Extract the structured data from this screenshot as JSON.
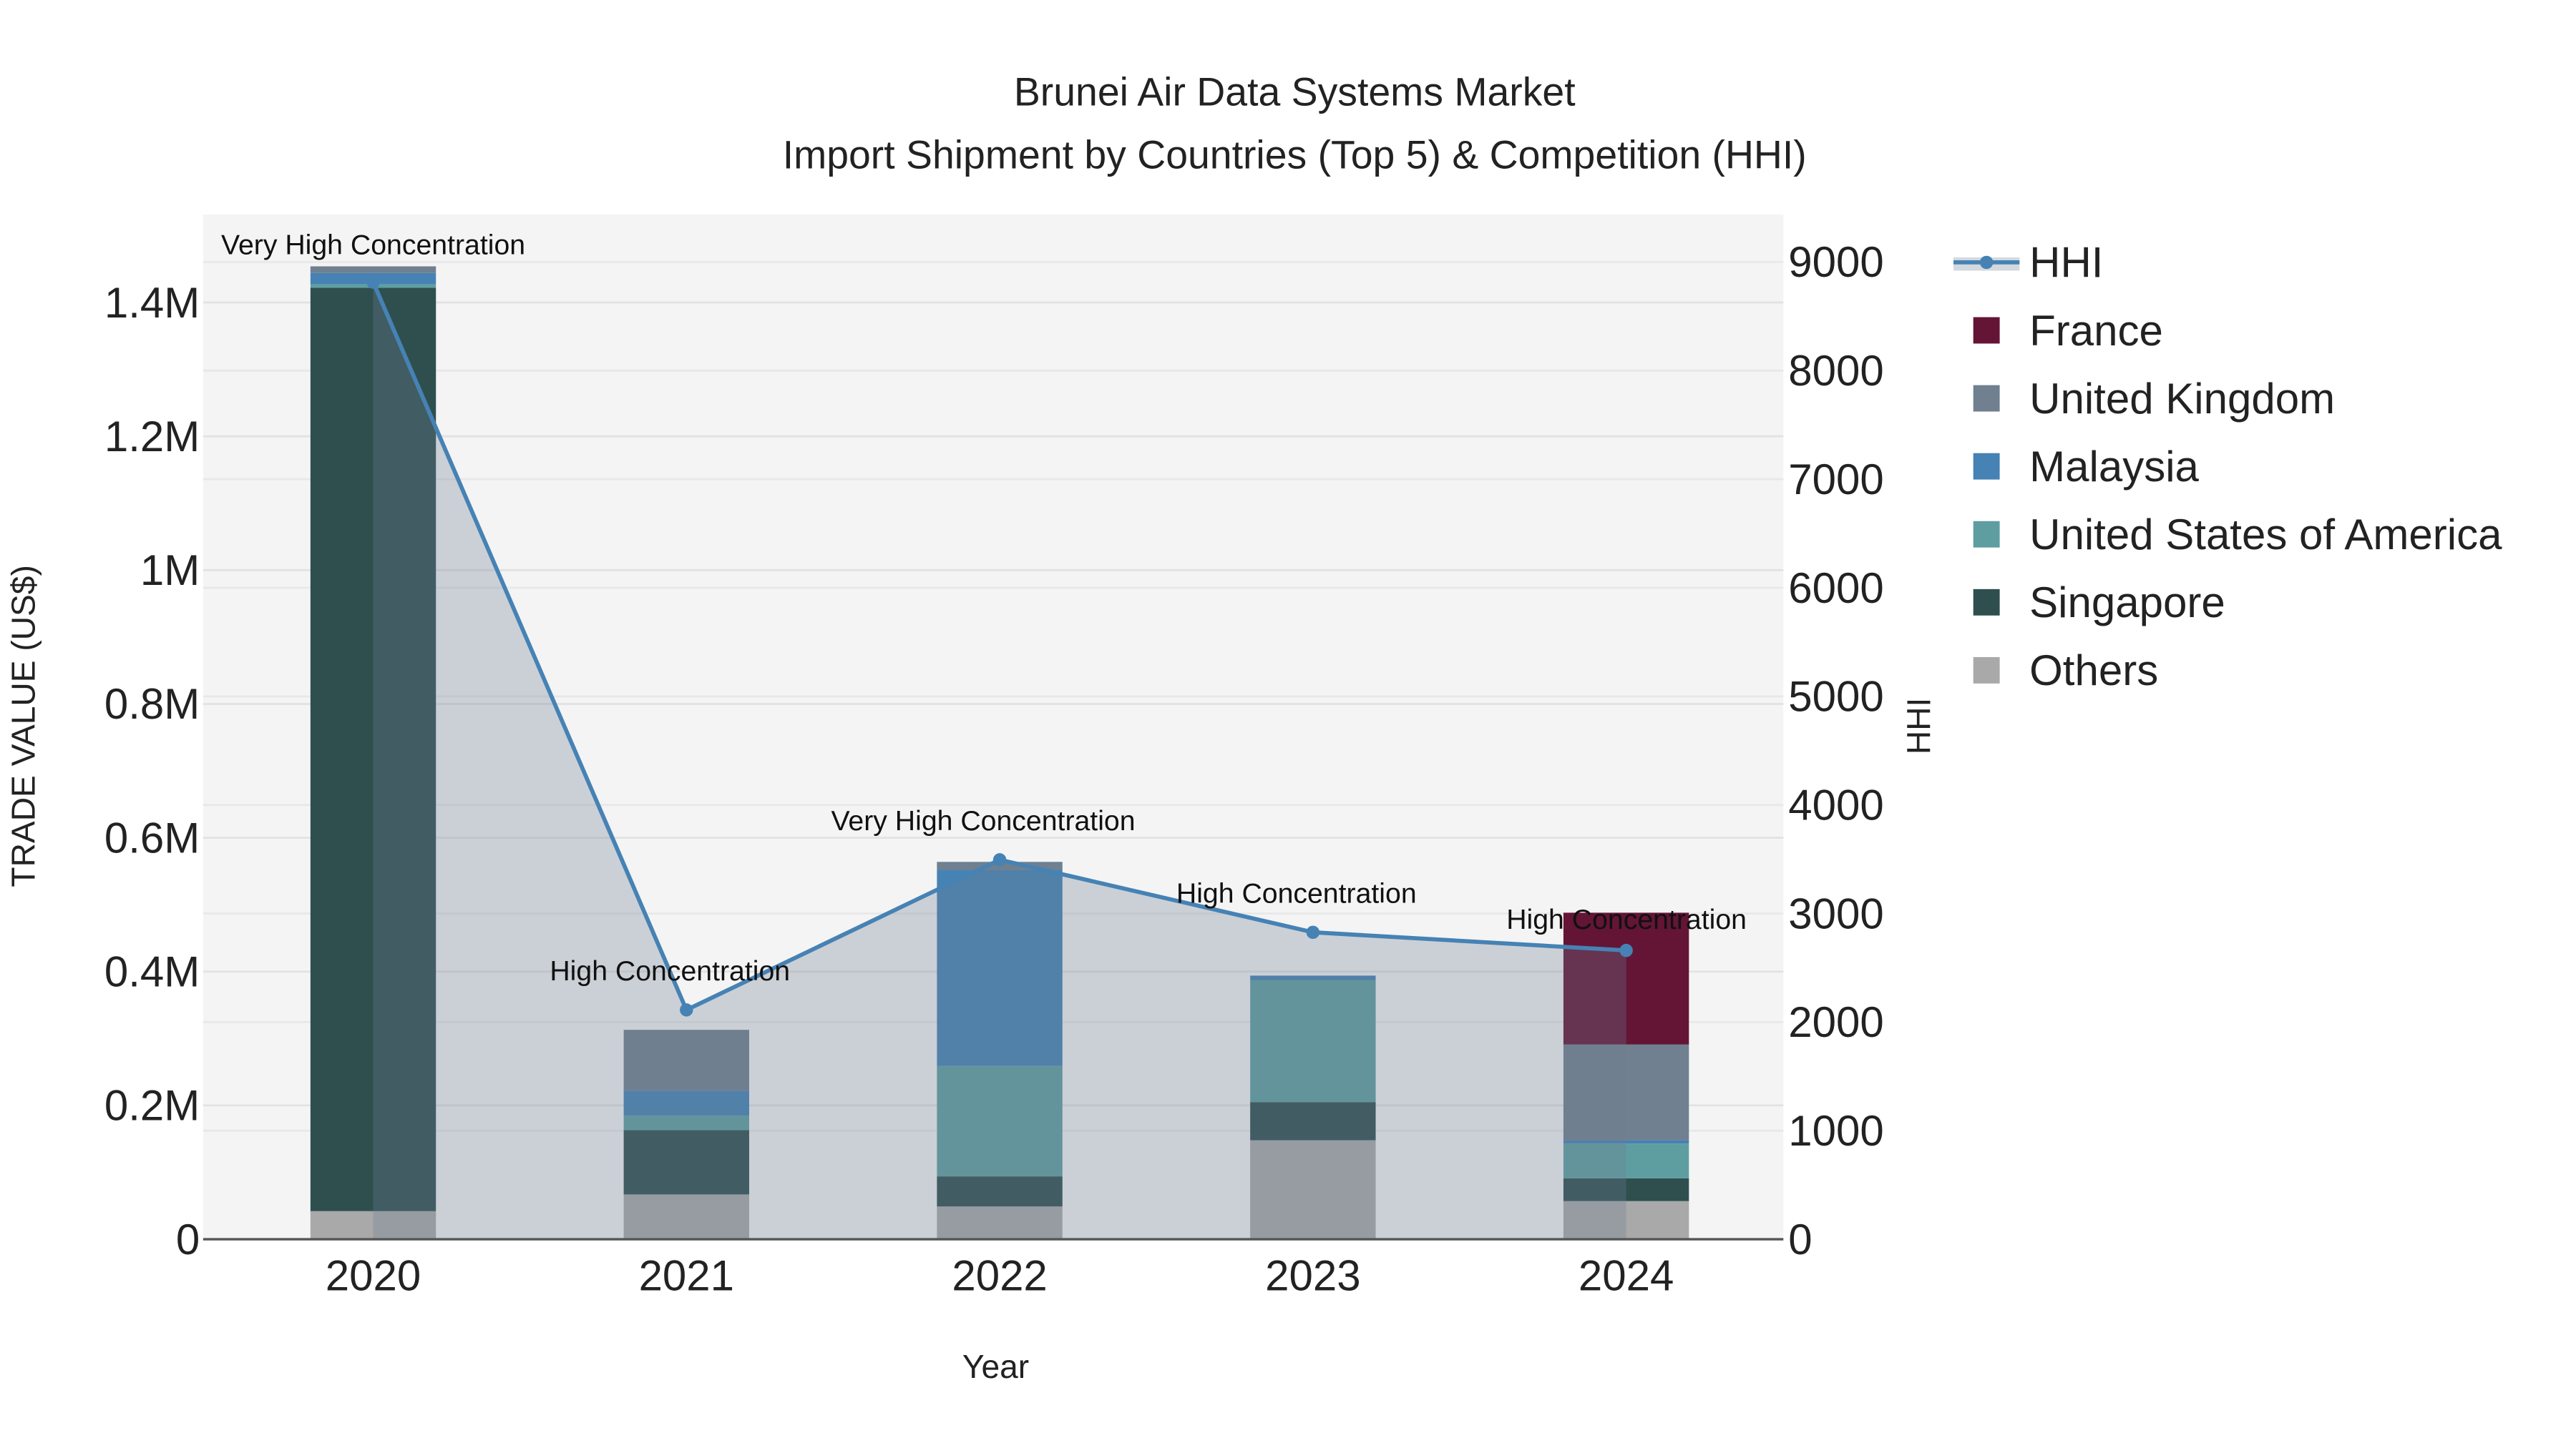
{
  "chart_data": {
    "type": "bar",
    "title": "Brunei Air Data Systems Market",
    "subtitle": "Import Shipment by Countries (Top 5) & Competition (HHI)",
    "xlabel": "Year",
    "ylabel": "TRADE VALUE (US$)",
    "y2label": "HHI",
    "categories": [
      "2020",
      "2021",
      "2022",
      "2023",
      "2024"
    ],
    "ylim": [
      0,
      1520000
    ],
    "y2lim": [
      0,
      9450
    ],
    "yticks": [
      0,
      200000,
      400000,
      600000,
      800000,
      1000000,
      1200000,
      1400000
    ],
    "ytick_labels": [
      "0",
      "0.2M",
      "0.4M",
      "0.6M",
      "0.8M",
      "1M",
      "1.2M",
      "1.4M"
    ],
    "y2ticks": [
      0,
      1000,
      2000,
      3000,
      4000,
      5000,
      6000,
      7000,
      8000,
      9000
    ],
    "y2tick_labels": [
      "0",
      "1000",
      "2000",
      "3000",
      "4000",
      "5000",
      "6000",
      "7000",
      "8000",
      "9000"
    ],
    "series": [
      {
        "name": "Others",
        "color": "#a9a9a9",
        "values": [
          42000,
          67000,
          49000,
          148000,
          57000
        ]
      },
      {
        "name": "Singapore",
        "color": "#2f4f4f",
        "values": [
          1380000,
          96000,
          45000,
          57000,
          34000
        ]
      },
      {
        "name": "United States of America",
        "color": "#5f9ea0",
        "values": [
          5000,
          22000,
          165000,
          182000,
          52000
        ]
      },
      {
        "name": "Malaysia",
        "color": "#4682b4",
        "values": [
          17000,
          37000,
          293000,
          7000,
          5000
        ]
      },
      {
        "name": "United Kingdom",
        "color": "#708090",
        "values": [
          10000,
          91000,
          12000,
          0,
          143000
        ]
      },
      {
        "name": "France",
        "color": "#641535",
        "values": [
          0,
          0,
          0,
          0,
          197000
        ]
      }
    ],
    "hhi": {
      "name": "HHI",
      "color": "#4682b4",
      "values": [
        8815,
        2112,
        3495,
        2827,
        2660
      ]
    },
    "annotations": [
      "Very High Concentration",
      "High Concentration",
      "Very High Concentration",
      "High Concentration",
      "High Concentration"
    ],
    "legend": [
      "HHI",
      "France",
      "United Kingdom",
      "Malaysia",
      "United States of America",
      "Singapore",
      "Others"
    ],
    "legend_position": "right",
    "grid": true
  }
}
